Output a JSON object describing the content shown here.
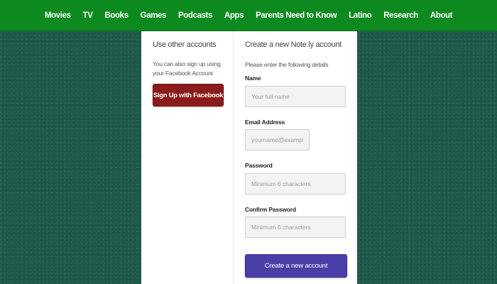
{
  "nav": {
    "items": [
      "Movies",
      "TV",
      "Books",
      "Games",
      "Podcasts",
      "Apps",
      "Parents Need to Know",
      "Latino",
      "Research",
      "About"
    ]
  },
  "left": {
    "heading": "Use other accounts",
    "description": "You can also sign up using your Facebook Account",
    "facebook_button": "Sign Up with Facebook"
  },
  "right": {
    "heading": "Create a new Note.ly account",
    "instructions": "Please enter the following details",
    "name": {
      "label": "Name",
      "placeholder": "Your full name",
      "value": ""
    },
    "email": {
      "label": "Email Address",
      "placeholder": "yourname@example.com",
      "value": ""
    },
    "password": {
      "label": "Password",
      "placeholder": "Minimum 6 characters",
      "value": ""
    },
    "confirm_password": {
      "label": "Confirm Password",
      "placeholder": "Minimum 6 characters",
      "value": ""
    },
    "submit_button": "Create a new account"
  },
  "colors": {
    "nav_background": "#0c8a1f",
    "page_background": "#1f5a4a",
    "facebook_button": "#8b1a1a",
    "submit_button": "#4a3fa8"
  }
}
